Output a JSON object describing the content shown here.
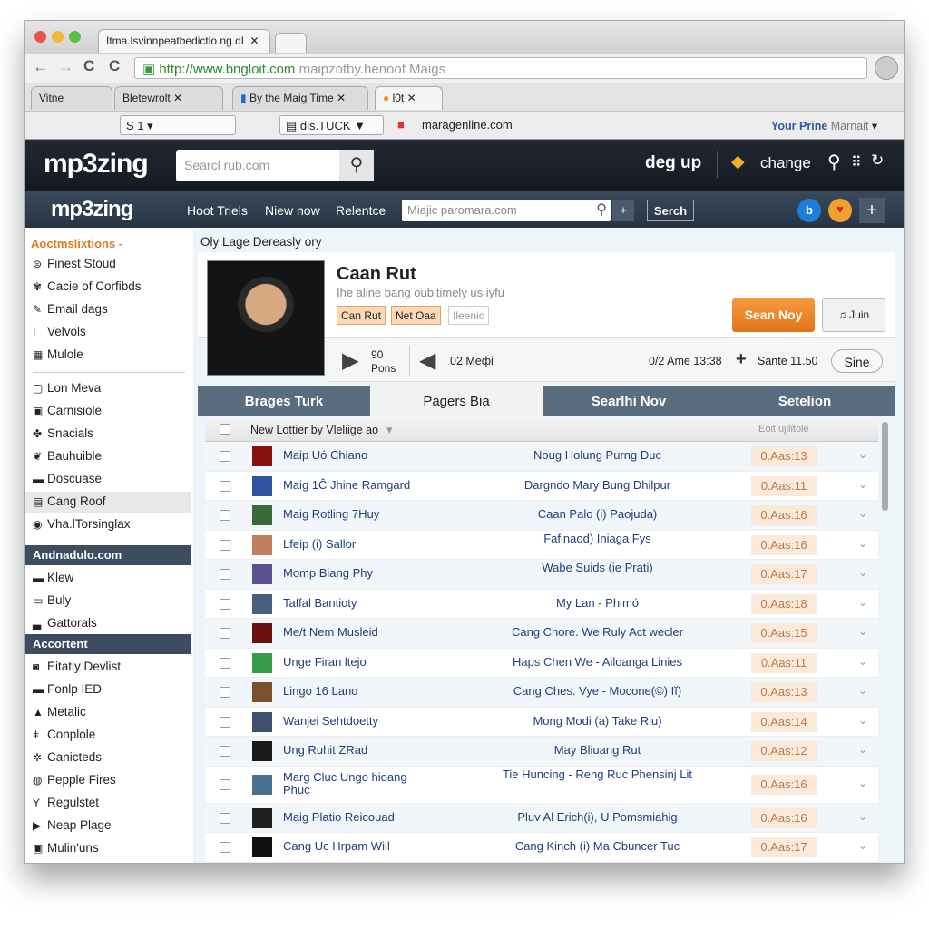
{
  "browser": {
    "window_tab": "Itma.lsvinnpeatbedictio.ng.dL",
    "url_host": "http://www.bngloit.com",
    "url_path": "maipzotby.henoof Maigs",
    "tabs": [
      "Vitne",
      "Bletewrolt",
      "By the Maig Time",
      "l0t"
    ],
    "bookmarks": {
      "select1": "S      1",
      "select2": "dis.TUCK",
      "site": "maragenline.com",
      "profile_strong": "Your Prine",
      "profile_rest": "Marnait"
    }
  },
  "header": {
    "logo": "mp3zing",
    "search_placeholder": "Searcl rub.com",
    "signup": "deg up",
    "change": "change"
  },
  "nav": {
    "logo": "mp3zing",
    "links": [
      "Hoot Triels",
      "Niew now",
      "Relentce"
    ],
    "search_value": "Miajic paromara.com",
    "search_button": "Serch"
  },
  "sidebar": {
    "section1": "Aoctmslixtions -",
    "group1": [
      {
        "icon": "⊜",
        "label": "Finest Stoud"
      },
      {
        "icon": "✾",
        "label": "Cacie of Corfibds"
      },
      {
        "icon": "✎",
        "label": "Email dags"
      },
      {
        "icon": "I",
        "label": "Velvols"
      },
      {
        "icon": "▦",
        "label": "Mulole"
      }
    ],
    "group2": [
      {
        "icon": "▢",
        "label": "Lon Meva"
      },
      {
        "icon": "▣",
        "label": "Carnisiole"
      },
      {
        "icon": "✤",
        "label": "Snacials"
      },
      {
        "icon": "❦",
        "label": "Bauhuible"
      },
      {
        "icon": "▬",
        "label": "Doscuase"
      },
      {
        "icon": "▤",
        "label": "Cang Roof"
      },
      {
        "icon": "◉",
        "label": "Vha.lTorsinglax"
      }
    ],
    "section2": "Andnadulo.com",
    "group3": [
      {
        "icon": "▬",
        "label": "Klew"
      },
      {
        "icon": "▭",
        "label": "Buly"
      },
      {
        "icon": "▃",
        "label": "Gattorals"
      }
    ],
    "section3": "Accortent",
    "group4": [
      {
        "icon": "◙",
        "label": "Eitatly Devlist"
      },
      {
        "icon": "▬",
        "label": "Fonlp IED"
      },
      {
        "icon": "▲",
        "label": "Metalic"
      },
      {
        "icon": "ǂ",
        "label": "Conplole"
      },
      {
        "icon": "✲",
        "label": "Canicteds"
      },
      {
        "icon": "◍",
        "label": "Pepple Fires"
      },
      {
        "icon": "Y",
        "label": "Regulstet"
      },
      {
        "icon": "▶",
        "label": "Neap Plage"
      },
      {
        "icon": "▣",
        "label": "Mulin'uns"
      }
    ]
  },
  "main": {
    "breadcrumb": "Oly Lage Dereasly ory",
    "artist": {
      "name": "Caan Rut",
      "subtitle": "Ihe aline bang oubitimely us iyfu",
      "tags": [
        "Can Rut",
        "Net Oaa",
        "Ileenio"
      ],
      "primary_button": "Sean Noy",
      "secondary_button": "Juin"
    },
    "player": {
      "count": "90",
      "count_label": "Pons",
      "prev_label": "02 Meфi",
      "time": "0/2 Ame 13:38",
      "add_label": "Sante 11.50",
      "button": "Sine"
    },
    "tabs": [
      "Brages Turk",
      "Pagers Bia",
      "Searlhi Nov",
      "Setelion"
    ],
    "table": {
      "header": "New Lottier by Vleliige ao",
      "header_right": "Eoit ujilitole",
      "rows": [
        {
          "title": "Maip Uó Chiano",
          "artist": "Noug Holung Purng Duc",
          "badge": "0.Aas:13"
        },
        {
          "title": "Maig 1Ĉ Jhine Ramgard",
          "artist": "Dargndo Mary Bung Dhilpur",
          "badge": "0.Aas:11"
        },
        {
          "title": "Maig Rotling 7Huy",
          "artist": "Caan Palo (i) Paojuda)",
          "badge": "0.Aas:16"
        },
        {
          "title": "Lfeip (i) Sallor",
          "artist": "Fafinaod) Iniaga Fys",
          "badge": "0.Aas:16"
        },
        {
          "title": "Momp Biang Phy",
          "artist": "Wabe Suids (ie Prati)",
          "badge": "0.Aas:17"
        },
        {
          "title": "Taffal Bantioty",
          "artist": "My Lan - Phimó",
          "badge": "0.Aas:18"
        },
        {
          "title": "Me/t Nem Musleid",
          "artist": "Cang Chore. We Ruly Act wecler",
          "badge": "0.Aas:15"
        },
        {
          "title": "Unge Firan ltejo",
          "artist": "Haps Chen We - Ailoanga Linies",
          "badge": "0.Aas:11"
        },
        {
          "title": "Lingo 16 Lano",
          "artist": "Cang Ches. Vye - Mocone(©) Iĭ)",
          "badge": "0.Aas:13"
        },
        {
          "title": "Wanjei Sehtdoetty",
          "artist": "Mong Modi (a) Take Riu)",
          "badge": "0.Aas:14"
        },
        {
          "title": "Ung Ruhit ZRad",
          "artist": "May Bliuang Rut",
          "badge": "0.Aas:12"
        },
        {
          "title": "Marg Cluc Ungo hioang Phuc",
          "artist": "Tie Huncing - Reng Ruc Phensinj Lit",
          "badge": "0.Aas:16"
        },
        {
          "title": "Maig Platio Reicouad",
          "artist": "Pluv Al Erich(i), U Pomsmiahig",
          "badge": "0.Aas:16"
        },
        {
          "title": "Cang Uc Hrpam Will",
          "artist": "Cang Kinch (i) Ma Cbuncer Tuc",
          "badge": "0.Aas:17"
        }
      ]
    }
  },
  "colors": {
    "accent": "#f08a2c",
    "header": "#1b212b",
    "nav": "#2f3e4f",
    "link": "#1f3f78"
  }
}
